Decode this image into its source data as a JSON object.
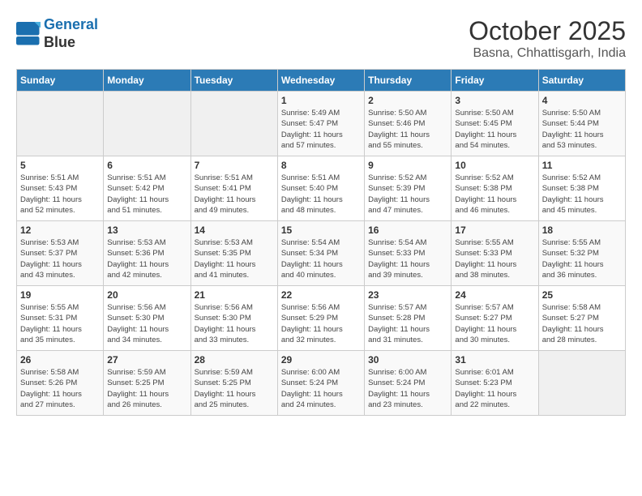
{
  "header": {
    "logo_line1": "General",
    "logo_line2": "Blue",
    "title": "October 2025",
    "subtitle": "Basna, Chhattisgarh, India"
  },
  "weekdays": [
    "Sunday",
    "Monday",
    "Tuesday",
    "Wednesday",
    "Thursday",
    "Friday",
    "Saturday"
  ],
  "weeks": [
    [
      {
        "day": "",
        "info": ""
      },
      {
        "day": "",
        "info": ""
      },
      {
        "day": "",
        "info": ""
      },
      {
        "day": "1",
        "info": "Sunrise: 5:49 AM\nSunset: 5:47 PM\nDaylight: 11 hours\nand 57 minutes."
      },
      {
        "day": "2",
        "info": "Sunrise: 5:50 AM\nSunset: 5:46 PM\nDaylight: 11 hours\nand 55 minutes."
      },
      {
        "day": "3",
        "info": "Sunrise: 5:50 AM\nSunset: 5:45 PM\nDaylight: 11 hours\nand 54 minutes."
      },
      {
        "day": "4",
        "info": "Sunrise: 5:50 AM\nSunset: 5:44 PM\nDaylight: 11 hours\nand 53 minutes."
      }
    ],
    [
      {
        "day": "5",
        "info": "Sunrise: 5:51 AM\nSunset: 5:43 PM\nDaylight: 11 hours\nand 52 minutes."
      },
      {
        "day": "6",
        "info": "Sunrise: 5:51 AM\nSunset: 5:42 PM\nDaylight: 11 hours\nand 51 minutes."
      },
      {
        "day": "7",
        "info": "Sunrise: 5:51 AM\nSunset: 5:41 PM\nDaylight: 11 hours\nand 49 minutes."
      },
      {
        "day": "8",
        "info": "Sunrise: 5:51 AM\nSunset: 5:40 PM\nDaylight: 11 hours\nand 48 minutes."
      },
      {
        "day": "9",
        "info": "Sunrise: 5:52 AM\nSunset: 5:39 PM\nDaylight: 11 hours\nand 47 minutes."
      },
      {
        "day": "10",
        "info": "Sunrise: 5:52 AM\nSunset: 5:38 PM\nDaylight: 11 hours\nand 46 minutes."
      },
      {
        "day": "11",
        "info": "Sunrise: 5:52 AM\nSunset: 5:38 PM\nDaylight: 11 hours\nand 45 minutes."
      }
    ],
    [
      {
        "day": "12",
        "info": "Sunrise: 5:53 AM\nSunset: 5:37 PM\nDaylight: 11 hours\nand 43 minutes."
      },
      {
        "day": "13",
        "info": "Sunrise: 5:53 AM\nSunset: 5:36 PM\nDaylight: 11 hours\nand 42 minutes."
      },
      {
        "day": "14",
        "info": "Sunrise: 5:53 AM\nSunset: 5:35 PM\nDaylight: 11 hours\nand 41 minutes."
      },
      {
        "day": "15",
        "info": "Sunrise: 5:54 AM\nSunset: 5:34 PM\nDaylight: 11 hours\nand 40 minutes."
      },
      {
        "day": "16",
        "info": "Sunrise: 5:54 AM\nSunset: 5:33 PM\nDaylight: 11 hours\nand 39 minutes."
      },
      {
        "day": "17",
        "info": "Sunrise: 5:55 AM\nSunset: 5:33 PM\nDaylight: 11 hours\nand 38 minutes."
      },
      {
        "day": "18",
        "info": "Sunrise: 5:55 AM\nSunset: 5:32 PM\nDaylight: 11 hours\nand 36 minutes."
      }
    ],
    [
      {
        "day": "19",
        "info": "Sunrise: 5:55 AM\nSunset: 5:31 PM\nDaylight: 11 hours\nand 35 minutes."
      },
      {
        "day": "20",
        "info": "Sunrise: 5:56 AM\nSunset: 5:30 PM\nDaylight: 11 hours\nand 34 minutes."
      },
      {
        "day": "21",
        "info": "Sunrise: 5:56 AM\nSunset: 5:30 PM\nDaylight: 11 hours\nand 33 minutes."
      },
      {
        "day": "22",
        "info": "Sunrise: 5:56 AM\nSunset: 5:29 PM\nDaylight: 11 hours\nand 32 minutes."
      },
      {
        "day": "23",
        "info": "Sunrise: 5:57 AM\nSunset: 5:28 PM\nDaylight: 11 hours\nand 31 minutes."
      },
      {
        "day": "24",
        "info": "Sunrise: 5:57 AM\nSunset: 5:27 PM\nDaylight: 11 hours\nand 30 minutes."
      },
      {
        "day": "25",
        "info": "Sunrise: 5:58 AM\nSunset: 5:27 PM\nDaylight: 11 hours\nand 28 minutes."
      }
    ],
    [
      {
        "day": "26",
        "info": "Sunrise: 5:58 AM\nSunset: 5:26 PM\nDaylight: 11 hours\nand 27 minutes."
      },
      {
        "day": "27",
        "info": "Sunrise: 5:59 AM\nSunset: 5:25 PM\nDaylight: 11 hours\nand 26 minutes."
      },
      {
        "day": "28",
        "info": "Sunrise: 5:59 AM\nSunset: 5:25 PM\nDaylight: 11 hours\nand 25 minutes."
      },
      {
        "day": "29",
        "info": "Sunrise: 6:00 AM\nSunset: 5:24 PM\nDaylight: 11 hours\nand 24 minutes."
      },
      {
        "day": "30",
        "info": "Sunrise: 6:00 AM\nSunset: 5:24 PM\nDaylight: 11 hours\nand 23 minutes."
      },
      {
        "day": "31",
        "info": "Sunrise: 6:01 AM\nSunset: 5:23 PM\nDaylight: 11 hours\nand 22 minutes."
      },
      {
        "day": "",
        "info": ""
      }
    ]
  ]
}
